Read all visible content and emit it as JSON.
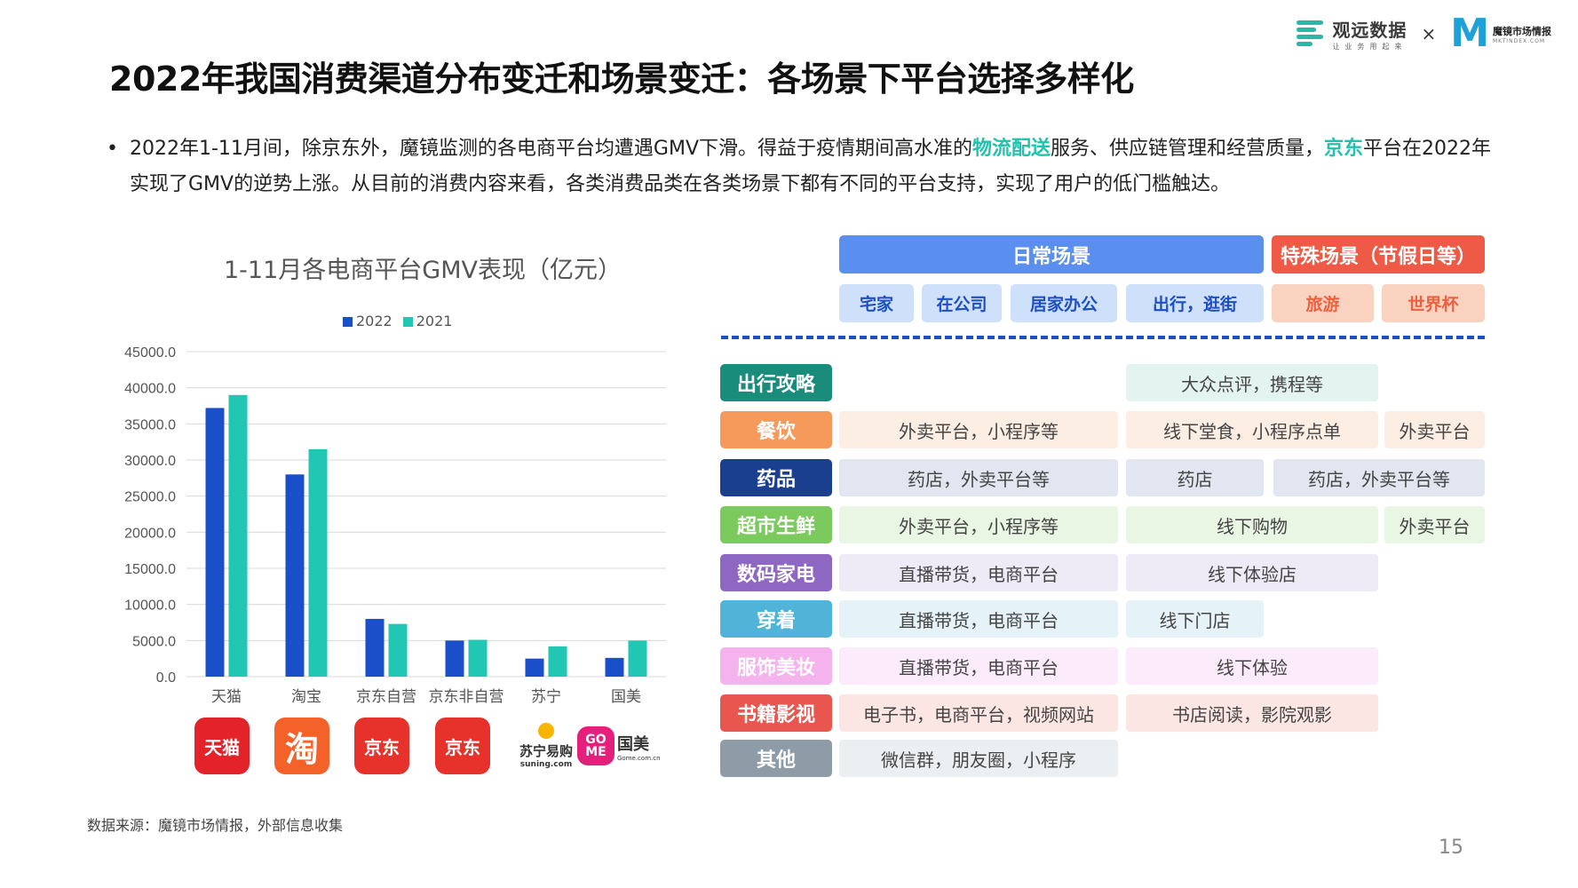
{
  "header": {
    "brand1_name": "观远数据",
    "brand1_slogan": "让业务用起来",
    "times": "×",
    "brand2_mark": "M",
    "brand2_name": "魔镜市场情报",
    "brand2_sub": "MKTINDEX.COM"
  },
  "title": "2022年我国消费渠道分布变迁和场景变迁：各场景下平台选择多样化",
  "intro": {
    "bullet": "•",
    "part1": "2022年1-11月间，除京东外，魔镜监测的各电商平台均遭遇GMV下滑。得益于疫情期间高水准的",
    "hl1": "物流配送",
    "part2": "服务、供应链管理和经营质量，",
    "hl2": "京东",
    "part3": "平台在2022年实现了GMV的逆势上涨。从目前的消费内容来看，各类消费品类在各类场景下都有不同的平台支持，实现了用户的低门槛触达。"
  },
  "chart_data": {
    "type": "bar",
    "title": "1-11月各电商平台GMV表现（亿元）",
    "categories": [
      "天猫",
      "淘宝",
      "京东自营",
      "京东非自营",
      "苏宁",
      "国美"
    ],
    "series": [
      {
        "name": "2022",
        "color": "#1a4fc9",
        "values": [
          37200,
          28000,
          8000,
          5000,
          2500,
          2600
        ]
      },
      {
        "name": "2021",
        "color": "#22c7b4",
        "values": [
          39000,
          31500,
          7300,
          5100,
          4200,
          5000
        ]
      }
    ],
    "ylim": [
      0,
      45000
    ],
    "yticks": [
      "0.0",
      "5000.0",
      "10000.0",
      "15000.0",
      "20000.0",
      "25000.0",
      "30000.0",
      "35000.0",
      "40000.0",
      "45000.0"
    ],
    "ytick_values": [
      0,
      5000,
      10000,
      15000,
      20000,
      25000,
      30000,
      35000,
      40000,
      45000
    ],
    "grid": true,
    "legend": "top-center"
  },
  "brand_icons": [
    {
      "name": "tmall-icon",
      "text": "天猫",
      "color": "#e3222a"
    },
    {
      "name": "taobao-icon",
      "text": "淘",
      "color": "#f4622a"
    },
    {
      "name": "jd-self-icon",
      "text": "京东",
      "color": "#e6322a"
    },
    {
      "name": "jd-other-icon",
      "text": "京东",
      "color": "#e6322a"
    },
    {
      "name": "suning-icon",
      "text": "苏宁易购",
      "sub": "suning.com",
      "color": "#f8b500"
    },
    {
      "name": "gome-icon",
      "text": "GO ME",
      "side": "国美",
      "side_sub": "Gome.com.cn",
      "color": "#e5207c"
    }
  ],
  "scenes": {
    "daily": "日常场景",
    "special": "特殊场景（节假日等）",
    "subs": [
      "宅家",
      "在公司",
      "居家办公",
      "出行，逛街",
      "旅游",
      "世界杯"
    ]
  },
  "rows": [
    {
      "label": "出行攻略",
      "color": "#1a8c7c",
      "cells": [
        "",
        "大众点评，携程等",
        ""
      ]
    },
    {
      "label": "餐饮",
      "color": "#f69a5c",
      "cells": [
        "外卖平台，小程序等",
        "线下堂食，小程序点单",
        "外卖平台"
      ]
    },
    {
      "label": "药品",
      "color": "#1b3f8f",
      "cells": [
        "药店，外卖平台等",
        "药店",
        "药店，外卖平台等"
      ]
    },
    {
      "label": "超市生鲜",
      "color": "#7cc95e",
      "cells": [
        "外卖平台，小程序等",
        "线下购物",
        "外卖平台"
      ]
    },
    {
      "label": "数码家电",
      "color": "#8e67c2",
      "cells": [
        "直播带货，电商平台",
        "线下体验店"
      ]
    },
    {
      "label": "穿着",
      "color": "#4fb4d8",
      "cells": [
        "直播带货，电商平台",
        "线下门店"
      ]
    },
    {
      "label": "服饰美妆",
      "color": "#f5b3ee",
      "cells": [
        "直播带货，电商平台",
        "线下体验"
      ]
    },
    {
      "label": "书籍影视",
      "color": "#e9564f",
      "cells": [
        "电子书，电商平台，视频网站",
        "书店阅读，影院观影"
      ]
    },
    {
      "label": "其他",
      "color": "#8e9ca8",
      "cells": [
        "微信群，朋友圈，小程序"
      ]
    }
  ],
  "source": "数据来源：魔镜市场情报，外部信息收集",
  "page_number": "15"
}
